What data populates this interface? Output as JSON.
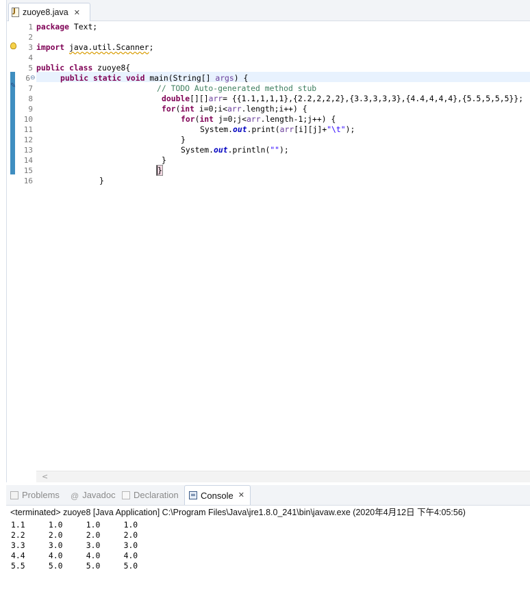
{
  "editor": {
    "tab": {
      "label": "zuoye8.java",
      "icon": "java-file-icon",
      "close": "✕"
    },
    "line_numbers": [
      "1",
      "2",
      "3",
      "4",
      "5",
      "6",
      "7",
      "8",
      "9",
      "10",
      "11",
      "12",
      "13",
      "14",
      "15",
      "16"
    ],
    "code": {
      "l1_kw": "package",
      "l1_rest": " Text;",
      "l3_kw": "import",
      "l3_import": "java.util.Scanner",
      "l3_end": ";",
      "l5_kw1": "public",
      "l5_kw2": "class",
      "l5_rest": " zuoye8{",
      "l6_kw1": "public",
      "l6_kw2": "static",
      "l6_kw3": "void",
      "l6_rest": " main(String[] ",
      "l6_args": "args",
      "l6_end": ") {",
      "l7_comment": "// TODO Auto-generated method stub",
      "l8_kw": "double",
      "l8_mid": "[][]",
      "l8_var": "arr",
      "l8_rest": "= {{1.1,1,1,1},{2.2,2,2,2},{3.3,3,3,3},{4.4,4,4,4},{5.5,5,5,5}};",
      "l9_kw1": "for",
      "l9_paren": "(",
      "l9_kw2": "int",
      "l9_rest": " i=0;i<",
      "l9_arr": "arr",
      "l9_end": ".length;i++) {",
      "l10_kw1": "for",
      "l10_paren": "(",
      "l10_kw2": "int",
      "l10_rest": " j=0;j<",
      "l10_arr": "arr",
      "l10_end": ".length-1;j++) {",
      "l11_a": "System.",
      "l11_out": "out",
      "l11_b": ".print(",
      "l11_arr": "arr",
      "l11_c": "[i][j]+",
      "l11_str": "\"\\t\"",
      "l11_d": ");",
      "l12": "}",
      "l13_a": "System.",
      "l13_out": "out",
      "l13_b": ".println(",
      "l13_str": "\"\"",
      "l13_c": ");",
      "l14": "}",
      "l15": "}",
      "l16": "}"
    },
    "scroll_left": "<"
  },
  "views": {
    "tabs": [
      {
        "label": "Problems",
        "icon": "problems-icon"
      },
      {
        "label": "Javadoc",
        "icon": "javadoc-icon",
        "glyph": "@"
      },
      {
        "label": "Declaration",
        "icon": "declaration-icon"
      },
      {
        "label": "Console",
        "icon": "console-icon",
        "active": true,
        "close": "✕"
      }
    ],
    "console_status": "<terminated> zuoye8 [Java Application] C:\\Program Files\\Java\\jre1.8.0_241\\bin\\javaw.exe (2020年4月12日 下午4:05:56)",
    "console_output": [
      "1.1\t1.0\t1.0\t1.0\t",
      "2.2\t2.0\t2.0\t2.0\t",
      "3.3\t3.0\t3.0\t3.0\t",
      "4.4\t4.0\t4.0\t4.0\t",
      "5.5\t5.0\t5.0\t5.0\t"
    ]
  },
  "colors": {
    "keyword": "#7f0055",
    "comment": "#3f7f5f",
    "string": "#2a00ff",
    "static_field": "#0000c0",
    "current_line": "#e8f2fe",
    "change_marker": "#3f8ec0"
  }
}
